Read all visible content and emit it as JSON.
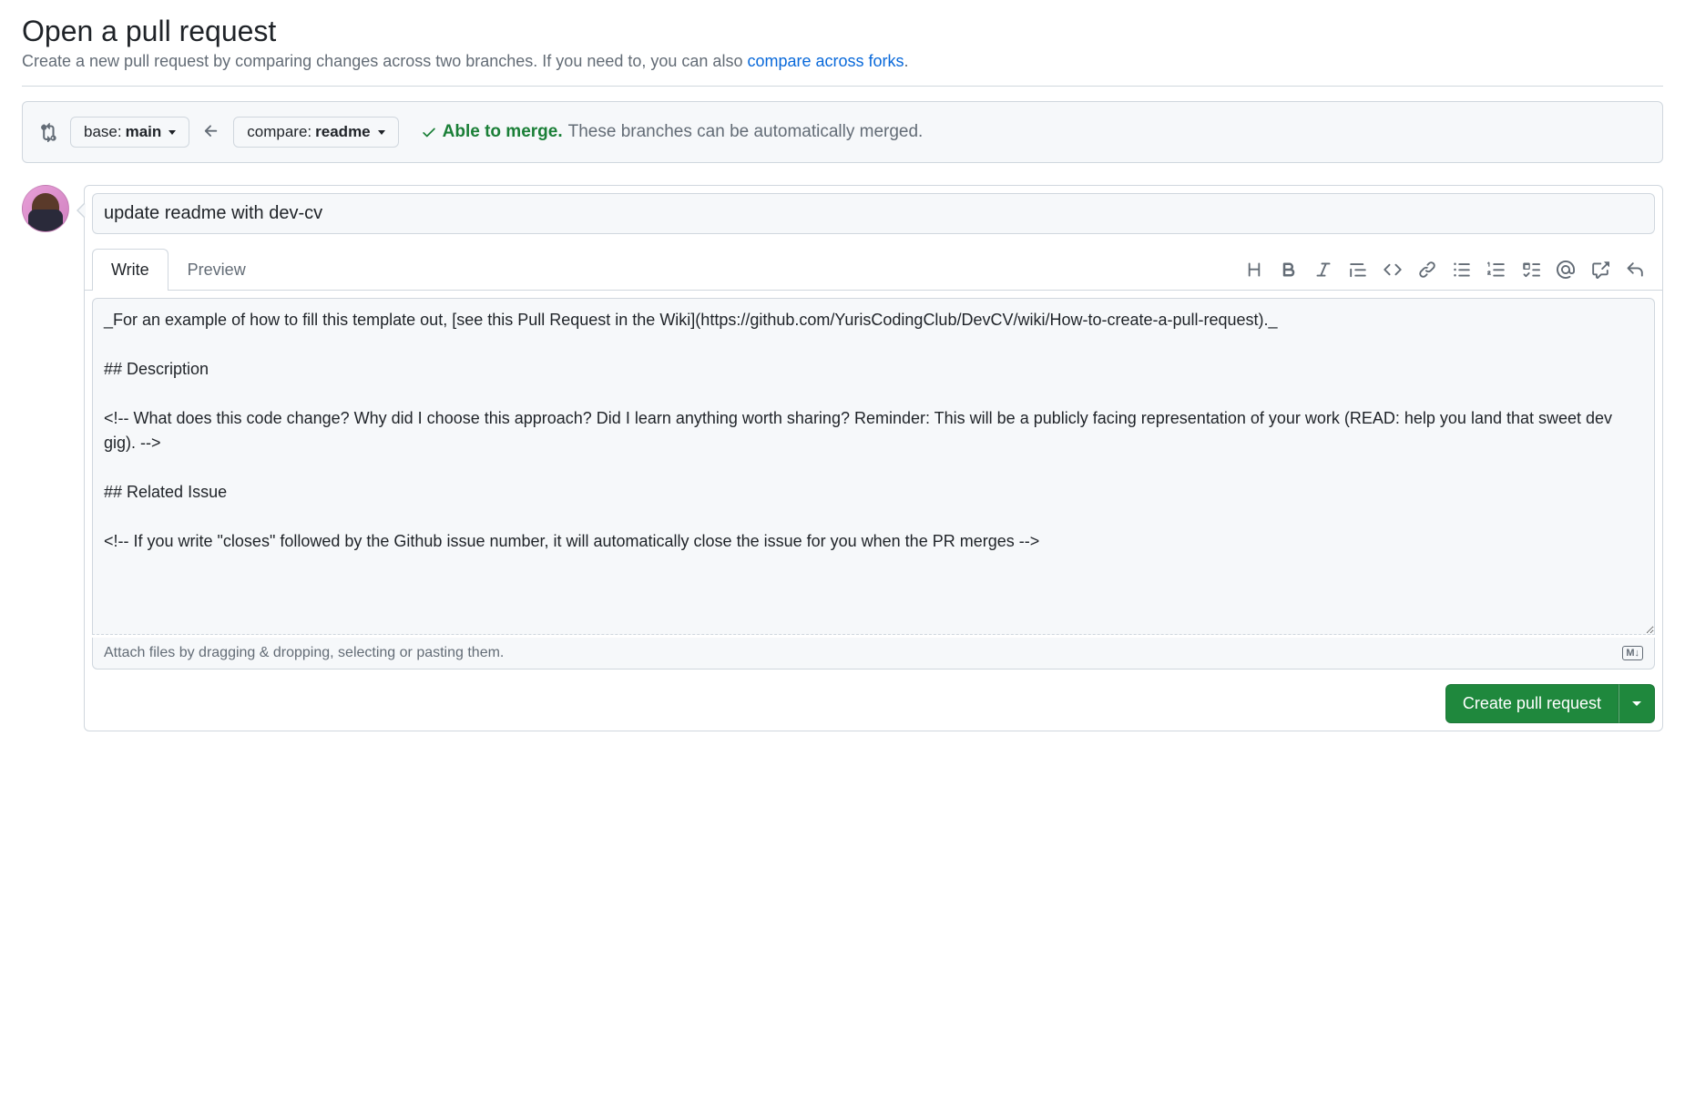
{
  "header": {
    "title": "Open a pull request",
    "subtitle_prefix": "Create a new pull request by comparing changes across two branches. If you need to, you can also ",
    "subtitle_link": "compare across forks",
    "subtitle_suffix": "."
  },
  "compare": {
    "base_label": "base:",
    "base_branch": "main",
    "compare_label": "compare:",
    "compare_branch": "readme",
    "status_ok": "Able to merge.",
    "status_detail": "These branches can be automatically merged."
  },
  "form": {
    "title_value": "update readme with dev-cv",
    "tabs": {
      "write": "Write",
      "preview": "Preview"
    },
    "body_value": "_For an example of how to fill this template out, [see this Pull Request in the Wiki](https://github.com/YurisCodingClub/DevCV/wiki/How-to-create-a-pull-request)._\n\n## Description\n\n<!-- What does this code change? Why did I choose this approach? Did I learn anything worth sharing? Reminder: This will be a publicly facing representation of your work (READ: help you land that sweet dev gig). -->\n\n## Related Issue\n\n<!-- If you write \"closes\" followed by the Github issue number, it will automatically close the issue for you when the PR merges -->",
    "attach_hint": "Attach files by dragging & dropping, selecting or pasting them.",
    "markdown_badge": "M↓",
    "submit_label": "Create pull request"
  }
}
